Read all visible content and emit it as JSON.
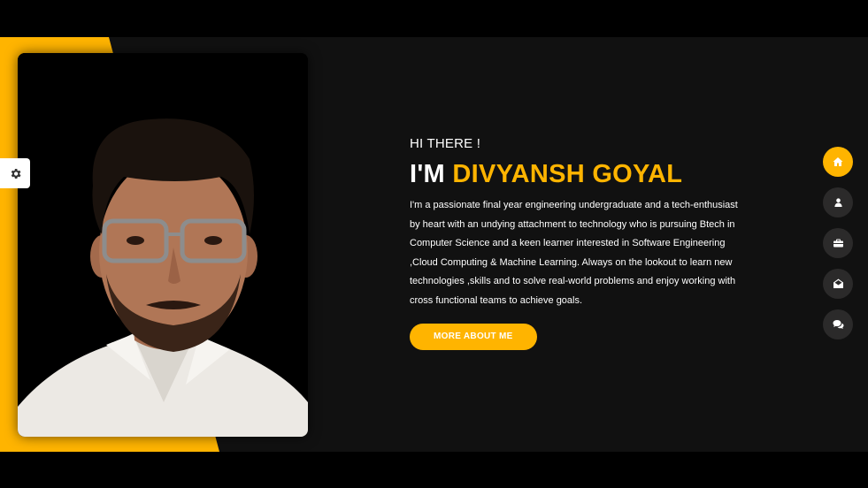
{
  "theme": {
    "accent": "#ffb400",
    "background": "#111111",
    "nav_inactive": "#2b2a2a",
    "text": "#ffffff"
  },
  "hero": {
    "greeting": "HI THERE !",
    "headline_prefix": "I'M",
    "name": "DIVYANSH GOYAL",
    "bio": "I'm a passionate final year engineering undergraduate and a tech-enthusiast by heart with an undying attachment to technology who is pursuing Btech in Computer Science and a keen learner interested in Software Engineering ,Cloud Computing & Machine Learning. Always on the lookout to learn new technologies ,skills and to solve real-world problems and enjoy working with cross functional teams to achieve goals.",
    "cta_label": "MORE ABOUT ME"
  },
  "settings": {
    "icon": "gear-icon"
  },
  "nav": {
    "items": [
      {
        "icon": "home-icon",
        "active": true
      },
      {
        "icon": "user-icon",
        "active": false
      },
      {
        "icon": "briefcase-icon",
        "active": false
      },
      {
        "icon": "envelope-open-icon",
        "active": false
      },
      {
        "icon": "comments-icon",
        "active": false
      }
    ]
  }
}
